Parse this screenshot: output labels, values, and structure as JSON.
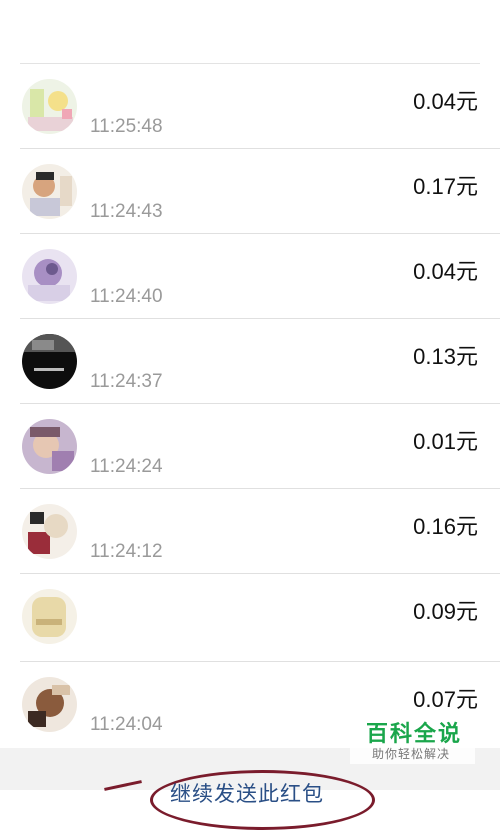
{
  "records": [
    {
      "time": "11:25:48",
      "amount": "0.04元"
    },
    {
      "time": "11:24:43",
      "amount": "0.17元"
    },
    {
      "time": "11:24:40",
      "amount": "0.04元"
    },
    {
      "time": "11:24:37",
      "amount": "0.13元"
    },
    {
      "time": "11:24:24",
      "amount": "0.01元"
    },
    {
      "time": "11:24:12",
      "amount": "0.16元"
    },
    {
      "time": "",
      "amount": "0.09元"
    },
    {
      "time": "11:24:04",
      "amount": "0.07元"
    }
  ],
  "footer": {
    "continue_label": "继续发送此红包"
  },
  "watermark": {
    "title": "百科全说",
    "subtitle": "助你轻松解决"
  },
  "colors": {
    "amount_text": "#111111",
    "time_text": "#9a9a9a",
    "link_text": "#2a4f86",
    "annotation": "#7a1c2c",
    "watermark_green": "#1aa64b"
  }
}
